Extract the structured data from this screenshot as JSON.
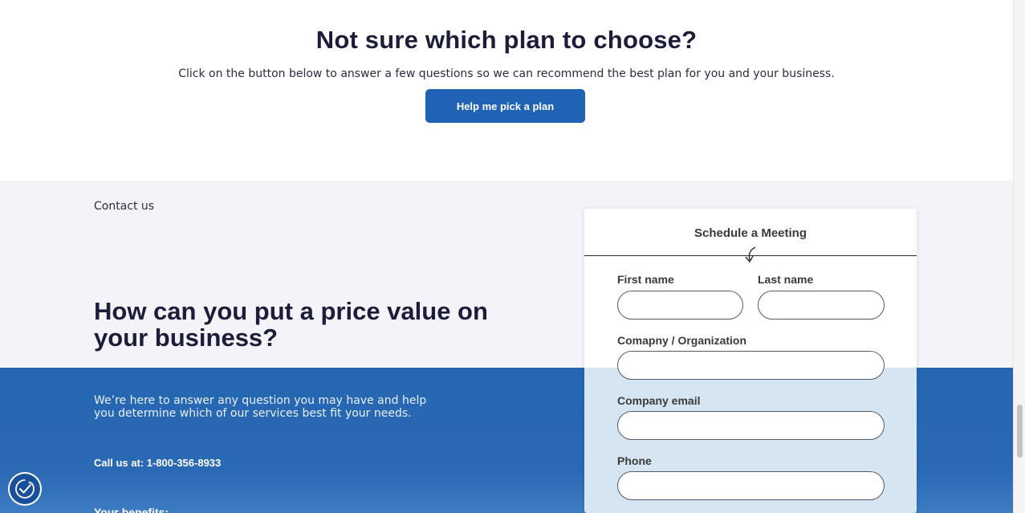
{
  "plan": {
    "title": "Not sure which plan to choose?",
    "subtitle": "Click on the button below to answer a few questions so we can recommend the best plan for you and your business.",
    "button_label": "Help me pick a plan"
  },
  "contact": {
    "label": "Contact us",
    "heading": "How can you put a price value on your business?",
    "description": "We’re here to answer any question you may have and help you determine which of our services best fit your needs.",
    "call": "Call us at: 1-800-356-8933",
    "benefits_heading": "Your benefits:"
  },
  "form": {
    "title": "Schedule a Meeting",
    "first_name_label": "First name",
    "first_name_value": "",
    "last_name_label": "Last name",
    "last_name_value": "",
    "company_label": "Comapny / Organization",
    "company_value": "",
    "email_label": "Company email",
    "email_value": "",
    "phone_label": "Phone",
    "phone_value": ""
  },
  "icons": {
    "accessibility": "accessibility-icon",
    "arrow": "curved-arrow-down-icon"
  },
  "colors": {
    "primary": "#2062b4",
    "heading": "#1b1d3a",
    "contact_bg": "#f3f3f8",
    "blue_band": "#2566b2",
    "form_lower": "#d6e5f2"
  }
}
